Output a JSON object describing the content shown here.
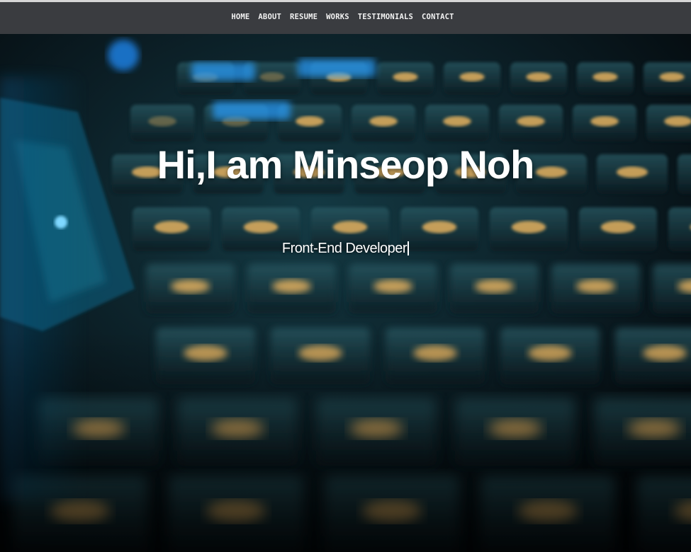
{
  "nav": {
    "items": [
      {
        "label": "HOME"
      },
      {
        "label": "ABOUT"
      },
      {
        "label": "RESUME"
      },
      {
        "label": "WORKS"
      },
      {
        "label": "TESTIMONIALS"
      },
      {
        "label": "CONTACT"
      }
    ]
  },
  "hero": {
    "title": "Hi,I am Minseop Noh",
    "subtitle": "Front-End Developer"
  },
  "colors": {
    "nav_background": "#3a3c40",
    "key_light": "#f0b860",
    "accent_blue": "#2aa0ff"
  }
}
